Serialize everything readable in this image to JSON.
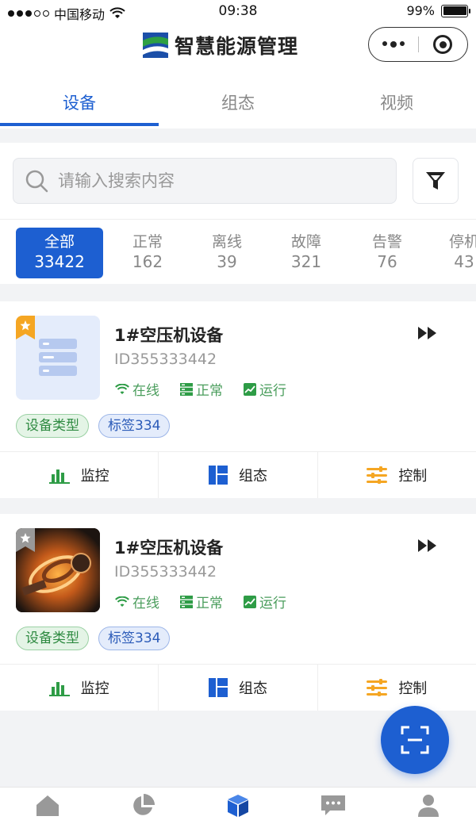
{
  "status_bar": {
    "carrier": "中国移动",
    "time": "09:38",
    "battery": "99%"
  },
  "header": {
    "title": "智慧能源管理"
  },
  "tabs": [
    {
      "label": "设备",
      "active": true
    },
    {
      "label": "组态",
      "active": false
    },
    {
      "label": "视频",
      "active": false
    }
  ],
  "search": {
    "placeholder": "请输入搜索内容"
  },
  "status_filters": [
    {
      "label": "全部",
      "count": "33422",
      "active": true
    },
    {
      "label": "正常",
      "count": "162"
    },
    {
      "label": "离线",
      "count": "39"
    },
    {
      "label": "故障",
      "count": "321"
    },
    {
      "label": "告警",
      "count": "76"
    },
    {
      "label": "停机",
      "count": "43"
    }
  ],
  "devices": [
    {
      "name": "1#空压机设备",
      "id": "ID355333442",
      "favorite": true,
      "states": [
        "在线",
        "正常",
        "运行"
      ],
      "tags": [
        "设备类型",
        "标签334"
      ]
    },
    {
      "name": "1#空压机设备",
      "id": "ID355333442",
      "favorite": false,
      "states": [
        "在线",
        "正常",
        "运行"
      ],
      "tags": [
        "设备类型",
        "标签334"
      ]
    }
  ],
  "card_actions": [
    "监控",
    "组态",
    "控制"
  ],
  "colors": {
    "accent": "#1d5fd1",
    "online": "#4a9d5c",
    "control": "#f5a623"
  },
  "bottom_nav_icons": [
    "home-icon",
    "pie-chart-icon",
    "cube-icon",
    "message-icon",
    "user-icon"
  ]
}
